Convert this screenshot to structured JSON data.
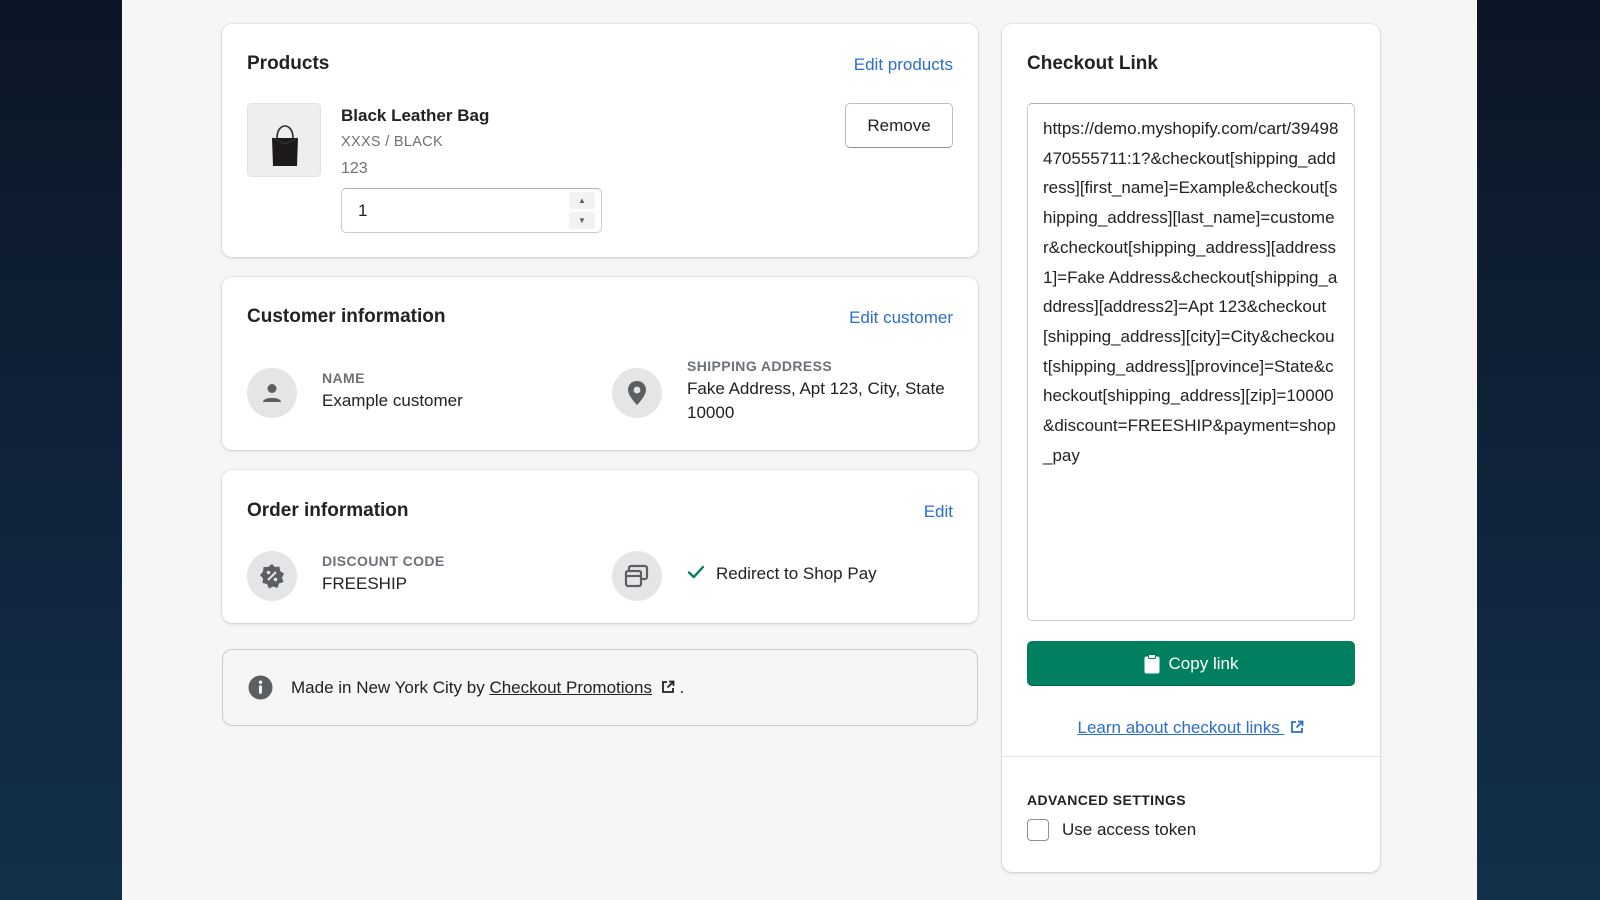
{
  "products": {
    "title": "Products",
    "edit_label": "Edit products",
    "item": {
      "name": "Black Leather Bag",
      "variant": "XXXS / BLACK",
      "sku": "123",
      "quantity": "1",
      "remove_label": "Remove"
    }
  },
  "customer": {
    "title": "Customer information",
    "edit_label": "Edit customer",
    "name_label": "NAME",
    "name_value": "Example customer",
    "address_label": "SHIPPING ADDRESS",
    "address_line1": "Fake Address, Apt 123, City, State",
    "address_line2": "10000"
  },
  "order": {
    "title": "Order information",
    "edit_label": "Edit",
    "discount_label": "DISCOUNT CODE",
    "discount_value": "FREESHIP",
    "redirect_label": "Redirect to Shop Pay"
  },
  "footer": {
    "prefix": "Made in New York City by",
    "link_label": "Checkout Promotions",
    "suffix": "."
  },
  "checkout": {
    "title": "Checkout Link",
    "url": "https://demo.myshopify.com/cart/39498470555711:1?&checkout[shipping_address][first_name]=Example&checkout[shipping_address][last_name]=customer&checkout[shipping_address][address1]=Fake Address&checkout[shipping_address][address2]=Apt 123&checkout[shipping_address][city]=City&checkout[shipping_address][province]=State&checkout[shipping_address][zip]=10000&discount=FREESHIP&payment=shop_pay",
    "copy_label": "Copy link",
    "learn_label": "Learn about checkout links",
    "advanced_label": "ADVANCED SETTINGS",
    "access_token_label": "Use access token",
    "access_token_checked": false
  },
  "colors": {
    "primary_button": "#008060",
    "link": "#2c6ecb",
    "check": "#008060"
  }
}
